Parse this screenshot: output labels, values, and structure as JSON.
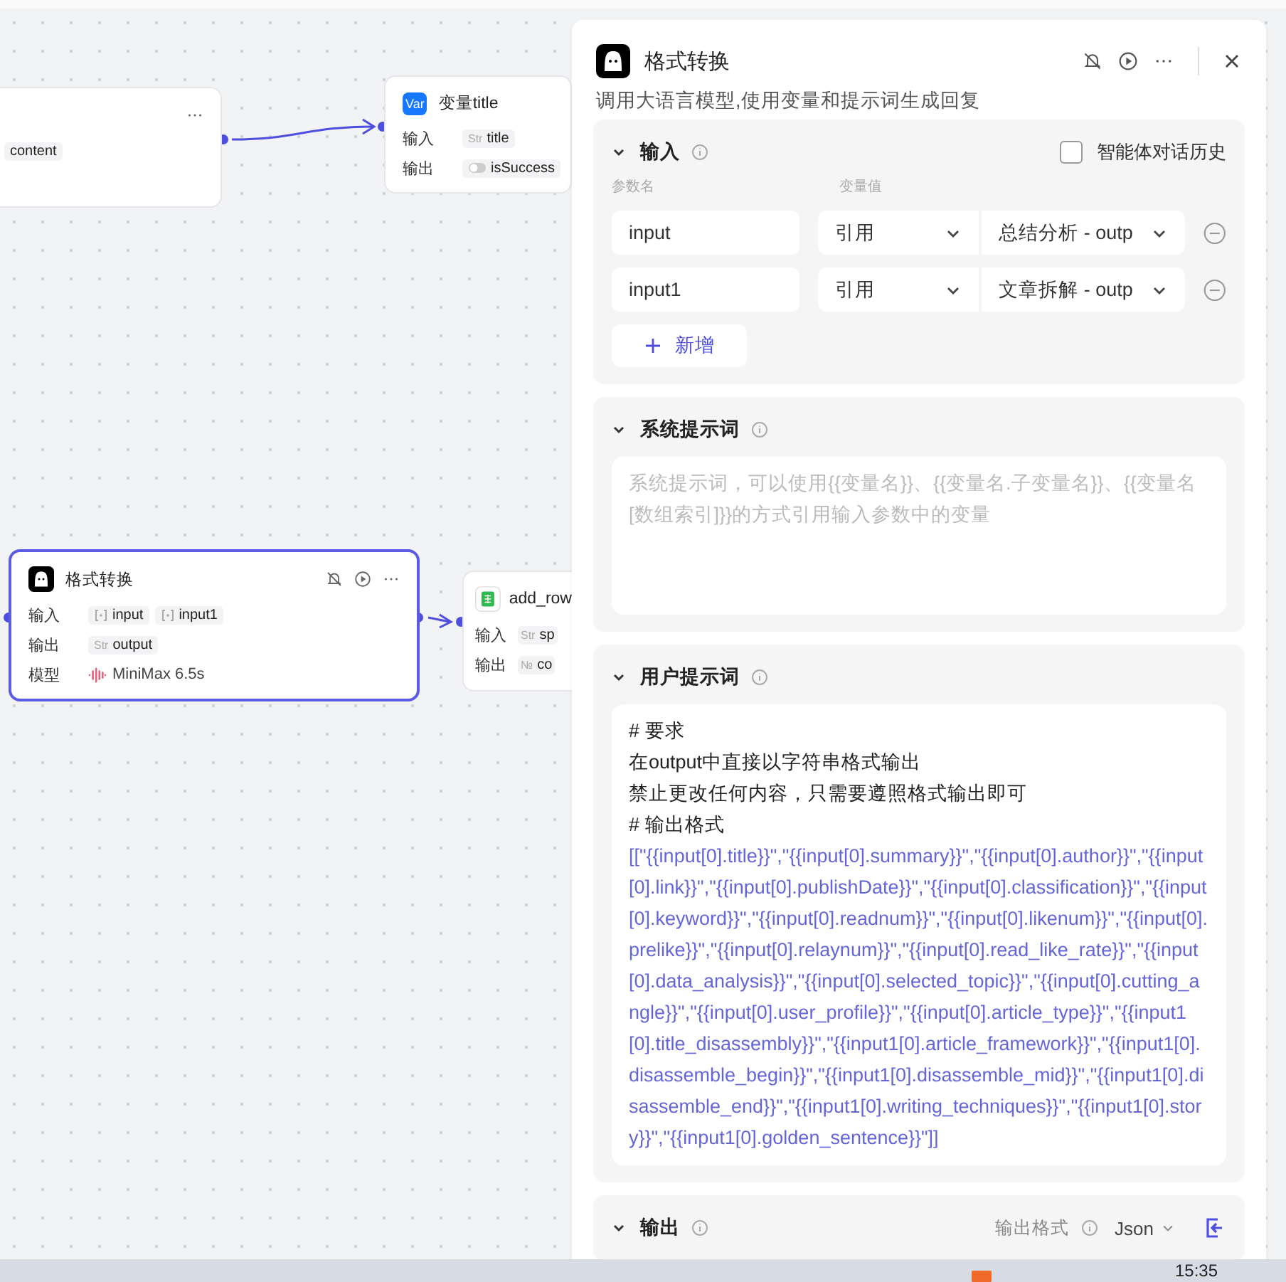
{
  "canvas": {
    "nodes": [
      {
        "selected": false,
        "rows": [
          {
            "tags": [
              {
                "kind": "string",
                "text": "content"
              }
            ]
          }
        ]
      },
      {
        "selected": false,
        "kind": "variable",
        "icon_text": "Var",
        "title": "变量title",
        "rows": [
          {
            "label": "输入",
            "tags": [
              {
                "kind": "string",
                "prefix": "Str",
                "text": "title"
              }
            ]
          },
          {
            "label": "输出",
            "tags": [
              {
                "kind": "boolean",
                "text": "isSuccess"
              }
            ]
          }
        ]
      },
      {
        "selected": true,
        "kind": "llm",
        "title": "格式转换",
        "rows": [
          {
            "label": "输入",
            "tags": [
              {
                "kind": "array",
                "text": "input"
              },
              {
                "kind": "array",
                "text": "input1"
              }
            ]
          },
          {
            "label": "输出",
            "tags": [
              {
                "kind": "string",
                "prefix": "Str",
                "text": "output"
              }
            ]
          },
          {
            "label": "模型",
            "tags": [
              {
                "kind": "model",
                "text": "MiniMax 6.5s"
              }
            ]
          }
        ]
      },
      {
        "selected": false,
        "kind": "sheet",
        "title": "add_row",
        "rows": [
          {
            "label": "输入",
            "tags": [
              {
                "kind": "string",
                "prefix": "Str",
                "text": "sp"
              }
            ]
          },
          {
            "label": "输出",
            "tags": [
              {
                "kind": "number",
                "prefix": "№",
                "text": "co"
              }
            ]
          }
        ]
      }
    ]
  },
  "panel": {
    "title": "格式转换",
    "description": "调用大语言模型,使用变量和提示词生成回复",
    "input": {
      "title": "输入",
      "history": {
        "label": "智能体对话历史",
        "checked": false
      },
      "columns": [
        "参数名",
        "变量值"
      ],
      "rows": [
        {
          "name": "input",
          "type": "引用",
          "value": "总结分析 - outp"
        },
        {
          "name": "input1",
          "type": "引用",
          "value": "文章拆解 - outp"
        }
      ],
      "add_button": "新增"
    },
    "system_prompt": {
      "title": "系统提示词",
      "placeholder": "系统提示词，可以使用{{变量名}}、{{变量名.子变量名}}、{{变量名[数组索引]}}的方式引用输入参数中的变量"
    },
    "user_prompt": {
      "title": "用户提示词",
      "lines": [
        "# 要求",
        "在output中直接以字符串格式输出",
        "禁止更改任何内容，只需要遵照格式输出即可",
        "# 输出格式"
      ],
      "template": "[[\"{{input[0].title}}\",\"{{input[0].summary}}\",\"{{input[0].author}}\",\"{{input[0].link}}\",\"{{input[0].publishDate}}\",\"{{input[0].classification}}\",\"{{input[0].keyword}}\",\"{{input[0].readnum}}\",\"{{input[0].likenum}}\",\"{{input[0].prelike}}\",\"{{input[0].relaynum}}\",\"{{input[0].read_like_rate}}\",\"{{input[0].data_analysis}}\",\"{{input[0].selected_topic}}\",\"{{input[0].cutting_angle}}\",\"{{input[0].user_profile}}\",\"{{input[0].article_type}}\",\"{{input1[0].title_disassembly}}\",\"{{input1[0].article_framework}}\",\"{{input1[0].disassemble_begin}}\",\"{{input1[0].disassemble_mid}}\",\"{{input1[0].disassemble_end}}\",\"{{input1[0].writing_techniques}}\",\"{{input1[0].story}}\",\"{{input1[0].golden_sentence}}\"]]"
    },
    "output": {
      "title": "输出",
      "format_label": "输出格式",
      "format": "Json"
    }
  },
  "taskbar": {
    "time": "15:35"
  }
}
